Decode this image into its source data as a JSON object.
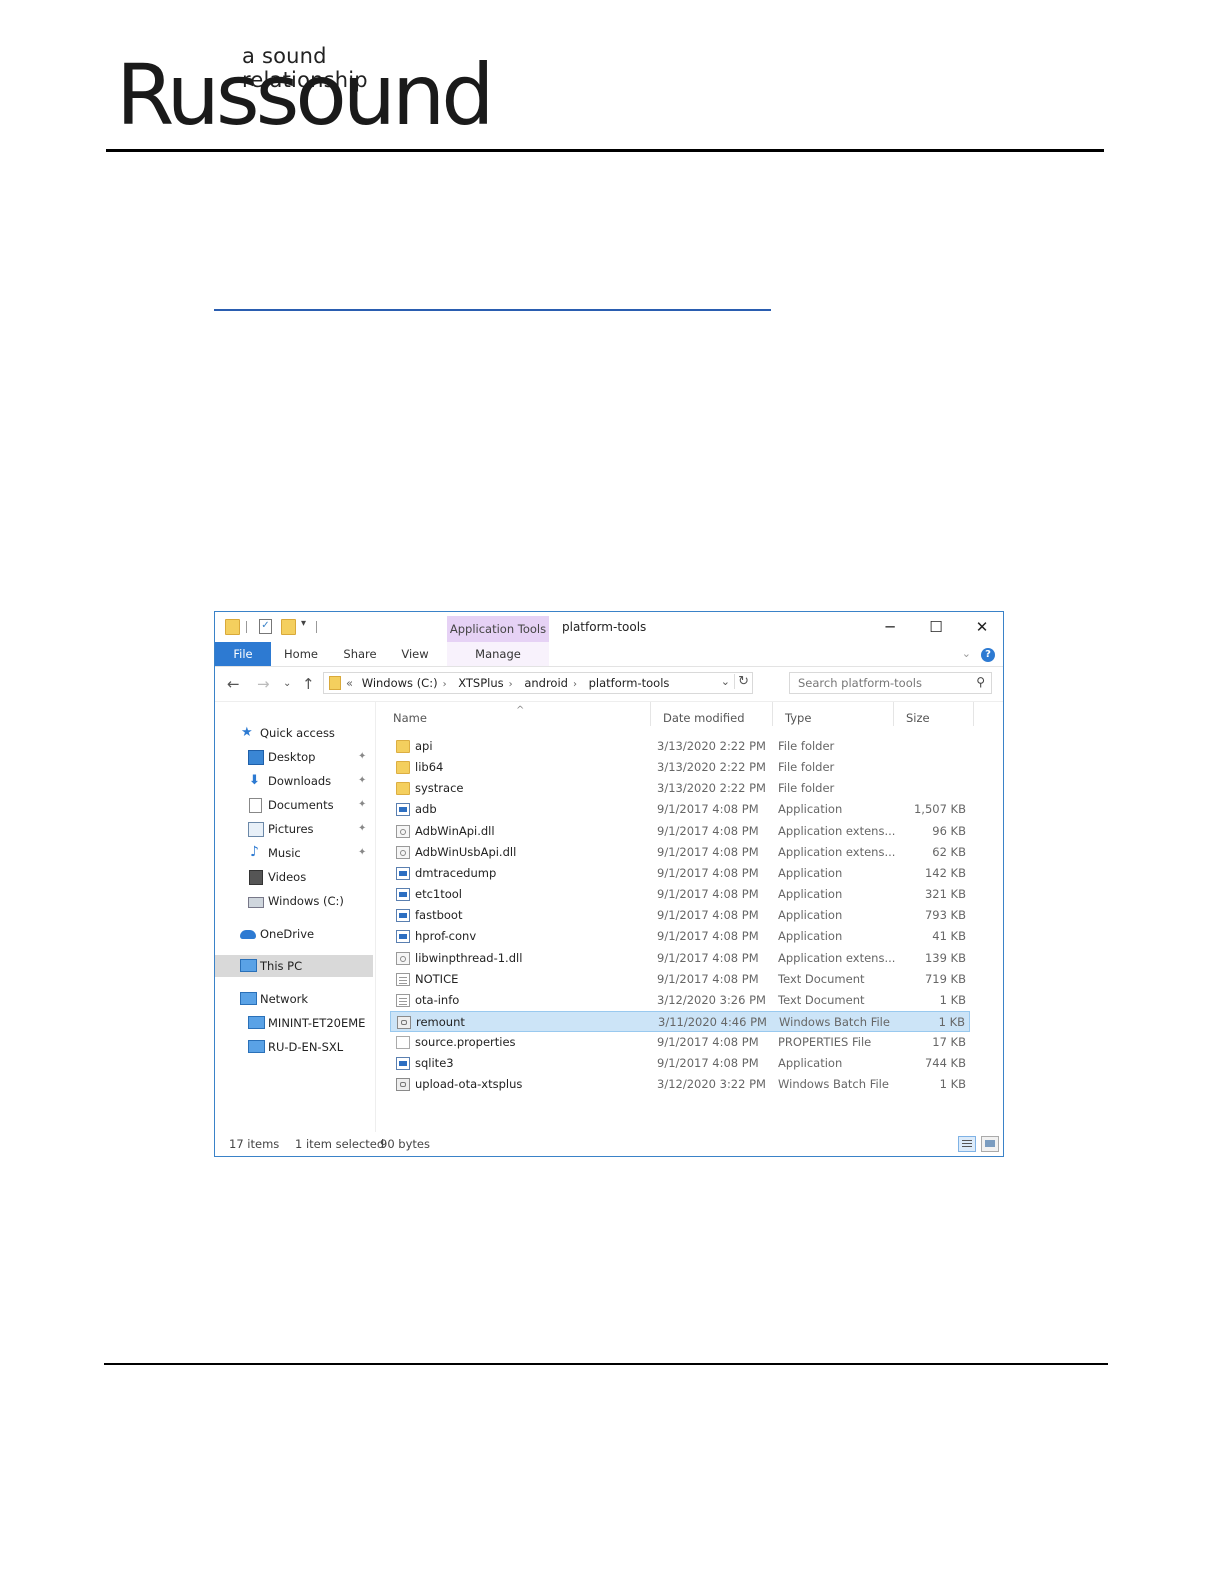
{
  "header": {
    "tagline": "a sound relationship",
    "brand": "Russound"
  },
  "window": {
    "context_tab": "Application Tools",
    "title": "platform-tools",
    "controls": {
      "minimize": "─",
      "maximize": "☐",
      "close": "✕"
    },
    "ribbon": {
      "tabs": [
        "File",
        "Home",
        "Share",
        "View"
      ],
      "manage": "Manage"
    },
    "address": {
      "overflow": "«",
      "crumbs": [
        "Windows (C:)",
        "XTSPlus",
        "android",
        "platform-tools"
      ],
      "search_placeholder": "Search platform-tools"
    },
    "nav_pane": [
      {
        "label": "Quick access",
        "icon": "star-icon",
        "indent": 0,
        "pinned": false
      },
      {
        "label": "Desktop",
        "icon": "desktop-icon",
        "indent": 1,
        "pinned": true
      },
      {
        "label": "Downloads",
        "icon": "download-arrow-icon",
        "indent": 1,
        "pinned": true
      },
      {
        "label": "Documents",
        "icon": "documents-icon",
        "indent": 1,
        "pinned": true
      },
      {
        "label": "Pictures",
        "icon": "pictures-icon",
        "indent": 1,
        "pinned": true
      },
      {
        "label": "Music",
        "icon": "music-note-icon",
        "indent": 1,
        "pinned": true
      },
      {
        "label": "Videos",
        "icon": "videos-icon",
        "indent": 1,
        "pinned": false
      },
      {
        "label": "Windows (C:)",
        "icon": "drive-icon",
        "indent": 1,
        "pinned": false
      },
      {
        "label": "OneDrive",
        "icon": "cloud-icon",
        "indent": 0,
        "pinned": false
      },
      {
        "label": "This PC",
        "icon": "computer-icon",
        "indent": 0,
        "pinned": false,
        "selected": true
      },
      {
        "label": "Network",
        "icon": "network-icon",
        "indent": 0,
        "pinned": false
      },
      {
        "label": "MININT-ET20EME",
        "icon": "computer-icon",
        "indent": 1,
        "pinned": false
      },
      {
        "label": "RU-D-EN-SXL",
        "icon": "computer-icon",
        "indent": 1,
        "pinned": false
      }
    ],
    "columns": [
      "Name",
      "Date modified",
      "Type",
      "Size"
    ],
    "files": [
      {
        "name": "api",
        "date": "3/13/2020 2:22 PM",
        "type": "File folder",
        "size": "",
        "icon": "folder"
      },
      {
        "name": "lib64",
        "date": "3/13/2020 2:22 PM",
        "type": "File folder",
        "size": "",
        "icon": "folder"
      },
      {
        "name": "systrace",
        "date": "3/13/2020 2:22 PM",
        "type": "File folder",
        "size": "",
        "icon": "folder"
      },
      {
        "name": "adb",
        "date": "9/1/2017 4:08 PM",
        "type": "Application",
        "size": "1,507 KB",
        "icon": "app"
      },
      {
        "name": "AdbWinApi.dll",
        "date": "9/1/2017 4:08 PM",
        "type": "Application extens...",
        "size": "96 KB",
        "icon": "dll"
      },
      {
        "name": "AdbWinUsbApi.dll",
        "date": "9/1/2017 4:08 PM",
        "type": "Application extens...",
        "size": "62 KB",
        "icon": "dll"
      },
      {
        "name": "dmtracedump",
        "date": "9/1/2017 4:08 PM",
        "type": "Application",
        "size": "142 KB",
        "icon": "app"
      },
      {
        "name": "etc1tool",
        "date": "9/1/2017 4:08 PM",
        "type": "Application",
        "size": "321 KB",
        "icon": "app"
      },
      {
        "name": "fastboot",
        "date": "9/1/2017 4:08 PM",
        "type": "Application",
        "size": "793 KB",
        "icon": "app"
      },
      {
        "name": "hprof-conv",
        "date": "9/1/2017 4:08 PM",
        "type": "Application",
        "size": "41 KB",
        "icon": "app"
      },
      {
        "name": "libwinpthread-1.dll",
        "date": "9/1/2017 4:08 PM",
        "type": "Application extens...",
        "size": "139 KB",
        "icon": "dll"
      },
      {
        "name": "NOTICE",
        "date": "9/1/2017 4:08 PM",
        "type": "Text Document",
        "size": "719 KB",
        "icon": "txt"
      },
      {
        "name": "ota-info",
        "date": "3/12/2020 3:26 PM",
        "type": "Text Document",
        "size": "1 KB",
        "icon": "txt"
      },
      {
        "name": "remount",
        "date": "3/11/2020 4:46 PM",
        "type": "Windows Batch File",
        "size": "1 KB",
        "icon": "bat",
        "selected": true
      },
      {
        "name": "source.properties",
        "date": "9/1/2017 4:08 PM",
        "type": "PROPERTIES File",
        "size": "17 KB",
        "icon": "prop"
      },
      {
        "name": "sqlite3",
        "date": "9/1/2017 4:08 PM",
        "type": "Application",
        "size": "744 KB",
        "icon": "app"
      },
      {
        "name": "upload-ota-xtsplus",
        "date": "3/12/2020 3:22 PM",
        "type": "Windows Batch File",
        "size": "1 KB",
        "icon": "bat"
      }
    ],
    "status": {
      "count": "17 items",
      "selection": "1 item selected",
      "size": "90 bytes"
    }
  }
}
